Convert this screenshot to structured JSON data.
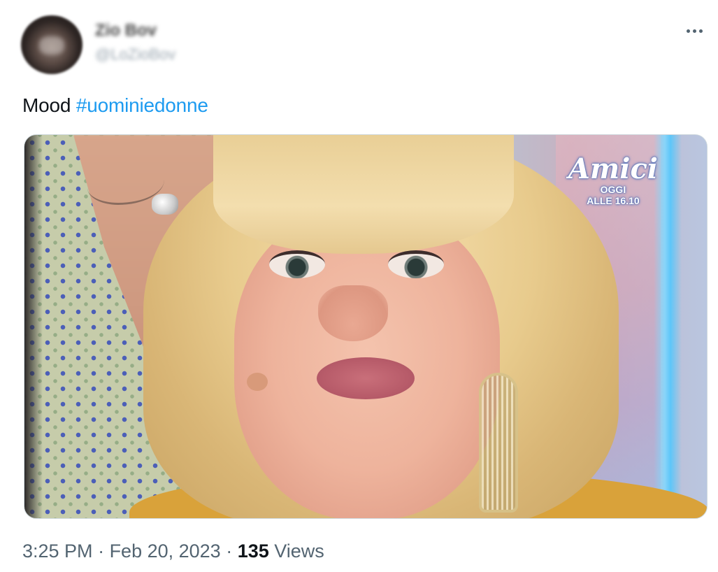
{
  "author": {
    "display_name": "Zio Bov",
    "handle": "@LoZioBov"
  },
  "tweet": {
    "text_plain": "Mood ",
    "hashtag": "#uominiedonne",
    "media_overlay": {
      "logo": "Amici",
      "subtext_line1": "OGGI",
      "subtext_line2": "ALLE 16.10"
    }
  },
  "meta": {
    "time": "3:25 PM",
    "separator": " · ",
    "date": "Feb 20, 2023",
    "views_count": "135",
    "views_label": " Views"
  },
  "colors": {
    "accent": "#1d9bf0",
    "text": "#0f1419",
    "secondary": "#536471"
  },
  "icons": {
    "more": "more-horizontal-icon"
  }
}
